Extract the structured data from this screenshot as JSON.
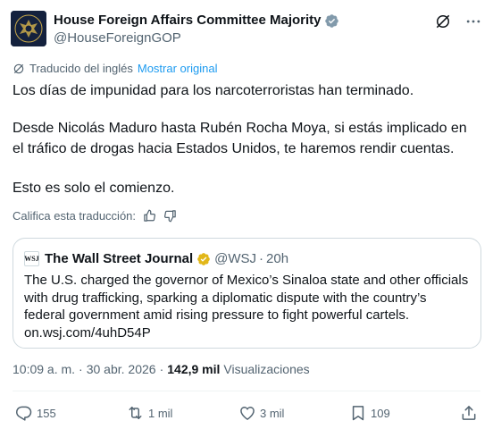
{
  "author": {
    "name": "House Foreign Affairs Committee Majority",
    "handle": "@HouseForeignGOP"
  },
  "translation": {
    "label": "Traducido del inglés",
    "show_original": "Mostrar original"
  },
  "tweet": {
    "paragraphs": [
      "Los días de impunidad para los narcoterroristas han terminado.",
      "Desde Nicolás Maduro hasta Rubén Rocha Moya, si estás implicado en el tráfico de drogas hacia Estados Unidos, te haremos rendir cuentas.",
      "Esto es solo el comienzo."
    ]
  },
  "rate": {
    "label": "Califica esta traducción:"
  },
  "quote": {
    "logo_text": "WSJ",
    "name": "The Wall Street Journal",
    "handle": "@WSJ",
    "separator": "·",
    "time": "20h",
    "text": "The U.S. charged the governor of Mexico’s Sinaloa state and other officials with drug trafficking, sparking a diplomatic dispute with the country’s federal government amid rising pressure to fight powerful cartels.",
    "link": "on.wsj.com/4uhD54P"
  },
  "meta": {
    "time": "10:09 a. m.",
    "separator": "·",
    "date": "30 abr. 2026",
    "views_count": "142,9 mil",
    "views_label": "Visualizaciones"
  },
  "actions": {
    "replies": "155",
    "reposts": "1 mil",
    "likes": "3 mil",
    "bookmarks": "109"
  },
  "colors": {
    "accent": "#1d9bf0",
    "verified_blue": "#1d9bf0",
    "verified_gold": "#e2b719",
    "secondary_text": "#536471",
    "border": "#cfd9de"
  },
  "icons": {
    "verified": "verified-badge-icon",
    "grok": "grok-icon",
    "more": "more-icon",
    "translate": "translate-icon",
    "thumbs_up": "thumbs-up-icon",
    "thumbs_down": "thumbs-down-icon",
    "reply": "reply-icon",
    "repost": "repost-icon",
    "like": "heart-icon",
    "bookmark": "bookmark-icon",
    "share": "share-icon"
  }
}
